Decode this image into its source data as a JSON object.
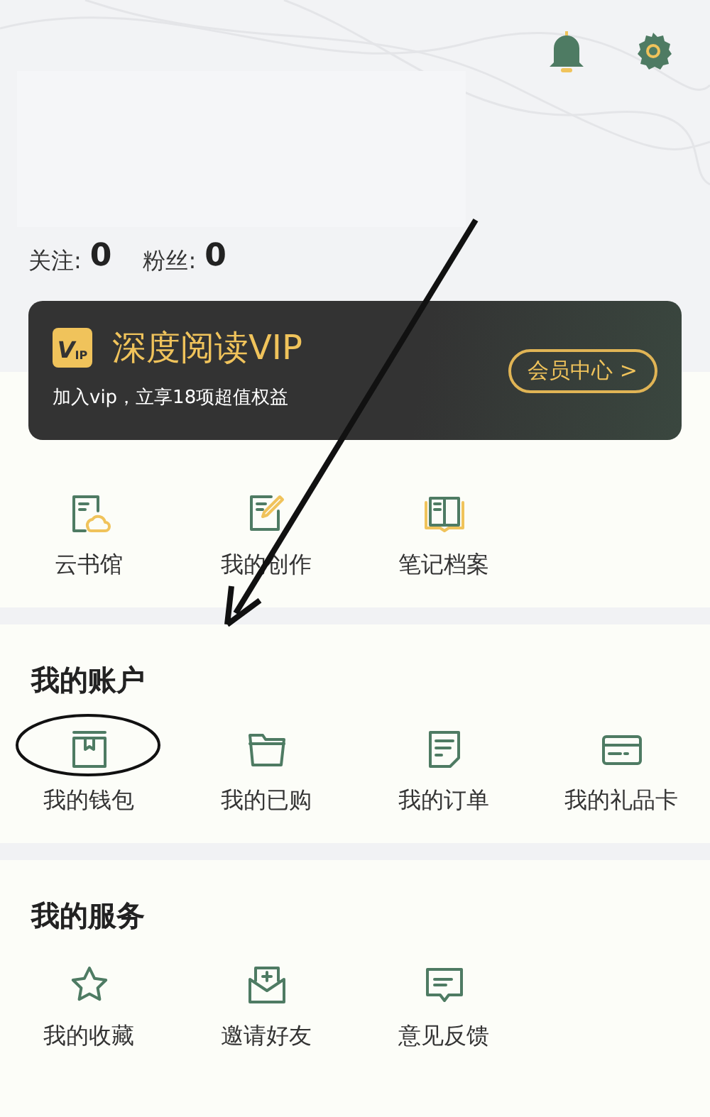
{
  "profile": {
    "following_label": "关注:",
    "following": "0",
    "followers_label": "粉丝:",
    "followers": "0"
  },
  "vip": {
    "badge": "V",
    "badge_sub": "IP",
    "title": "深度阅读VIP",
    "subtitle": "加入vip，立享18项超值权益",
    "button": "会员中心 >"
  },
  "quick_links": [
    {
      "label": "云书馆"
    },
    {
      "label": "我的创作"
    },
    {
      "label": "笔记档案"
    }
  ],
  "sections": [
    {
      "title": "我的账户",
      "items": [
        {
          "label": "我的钱包"
        },
        {
          "label": "我的已购"
        },
        {
          "label": "我的订单"
        },
        {
          "label": "我的礼品卡"
        }
      ]
    },
    {
      "title": "我的服务",
      "items": [
        {
          "label": "我的收藏"
        },
        {
          "label": "邀请好友"
        },
        {
          "label": "意见反馈"
        }
      ]
    }
  ]
}
